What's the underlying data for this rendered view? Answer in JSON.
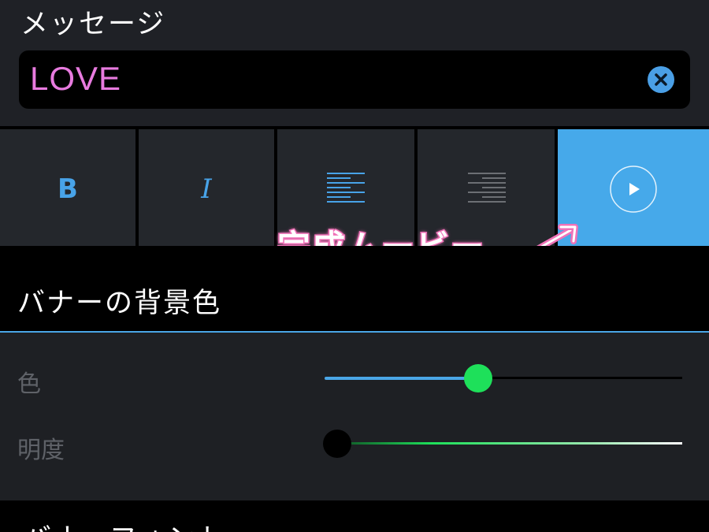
{
  "message": {
    "title": "メッセージ",
    "input_value": "LOVE"
  },
  "toolbar": {
    "bold_label": "B",
    "italic_label": "I",
    "icons": [
      "bold-icon",
      "italic-icon",
      "align-left-icon",
      "align-right-icon",
      "play-icon"
    ]
  },
  "annotation": {
    "text": "完成ムービー"
  },
  "background": {
    "title": "バナーの背景色",
    "hue_label": "色",
    "hue_value": 0.43,
    "brightness_label": "明度",
    "brightness_value": 0.0
  },
  "font_section": {
    "title": "バナーフォント"
  },
  "colors": {
    "accent": "#46a9ea",
    "text_pink": "#e87bdf",
    "thumb_green": "#1ee05a",
    "annotation_pink": "#f072b8"
  }
}
